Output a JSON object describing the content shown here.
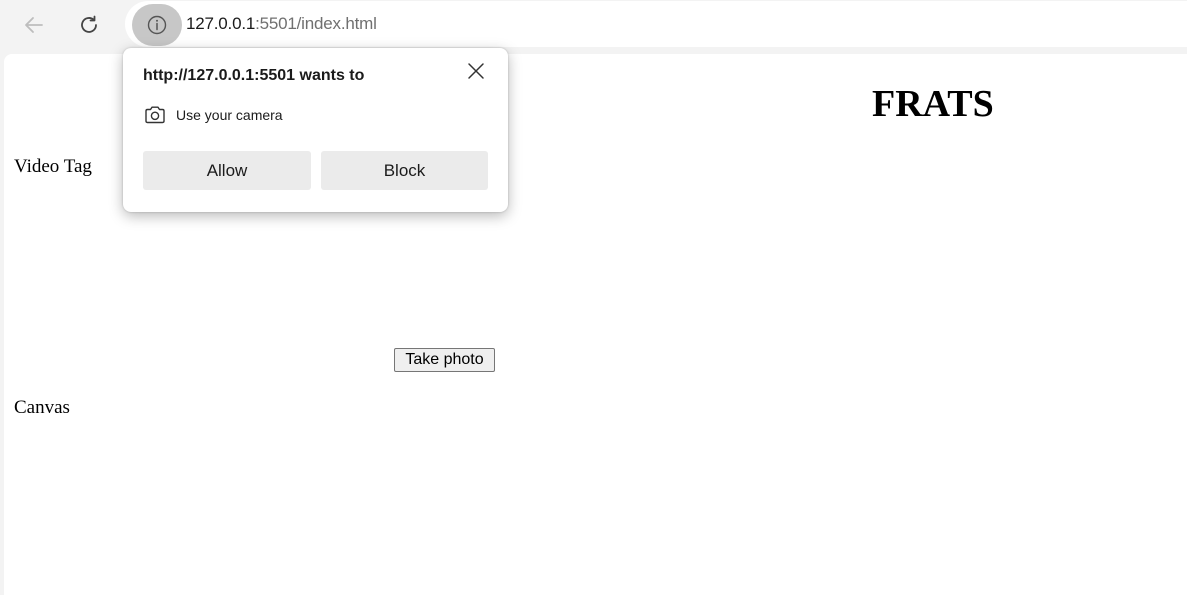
{
  "browser": {
    "back_icon": "arrow-left-icon",
    "refresh_icon": "refresh-icon",
    "site_info_icon": "info-icon",
    "url_host": "127.0.0.1",
    "url_rest": ":5501/index.html"
  },
  "permission_popup": {
    "title": "http://127.0.0.1:5501 wants to",
    "close_icon": "close-icon",
    "permission_icon": "camera-icon",
    "permission_text": "Use your camera",
    "allow_label": "Allow",
    "block_label": "Block"
  },
  "page": {
    "title": "FRATS",
    "video_label": "Video Tag",
    "take_photo_label": "Take photo",
    "canvas_label": "Canvas"
  }
}
